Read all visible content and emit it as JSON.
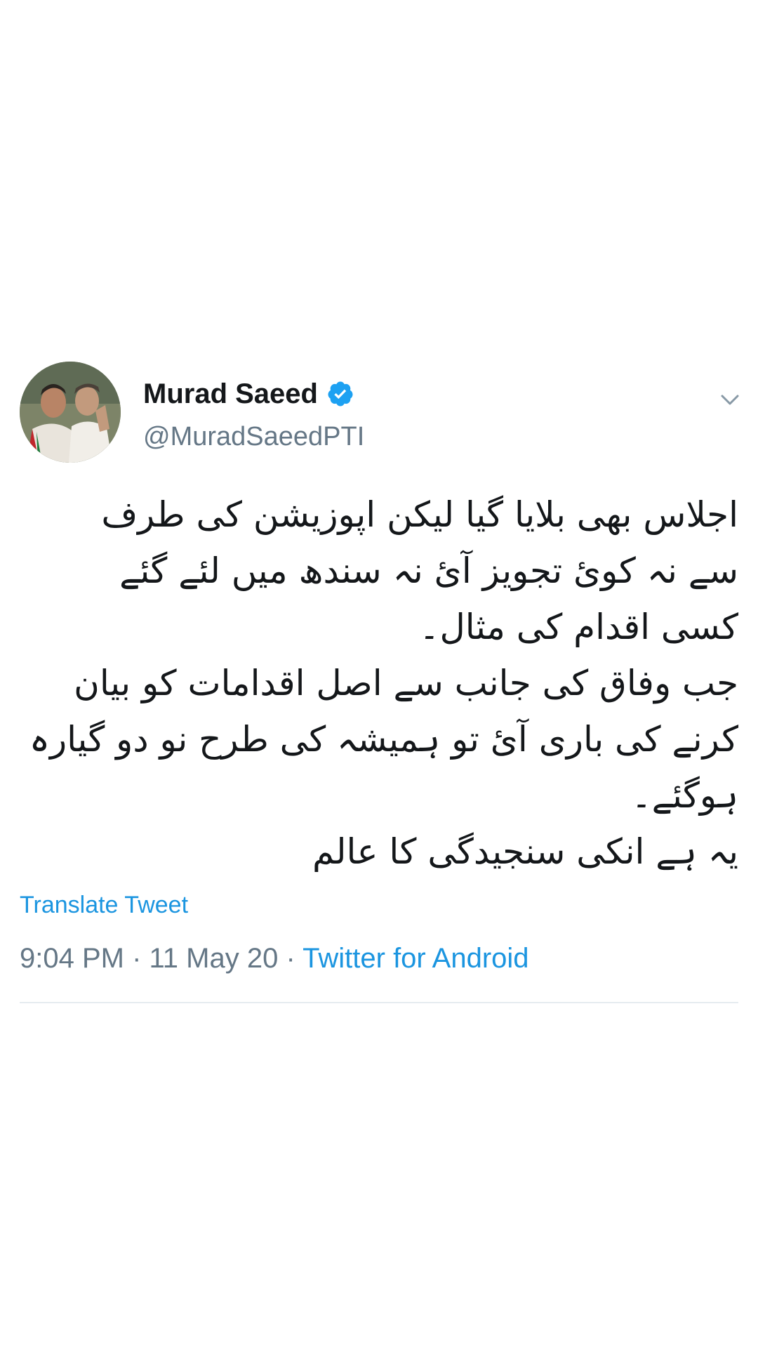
{
  "tweet": {
    "display_name": "Murad Saeed",
    "verified_icon": "verified-badge-icon",
    "handle": "@MuradSaeedPTI",
    "more_icon": "chevron-down-icon",
    "text_lines": [
      "اجلاس بھی بلایا گیا لیکن اپوزیشن کی طرف",
      "سے نہ کوئ تجویز آئ نہ سندھ میں لئے گئے",
      "کسی اقدام کی مثال۔",
      "جب وفاق کی جانب سے اصل اقدامات  کو بیان",
      "کرنے کی باری آئ تو ہمیشہ کی طرح نو دو گیارہ",
      "ہوگئے۔",
      "یہ ہے انکی سنجیدگی کا عالم"
    ],
    "translate_label": "Translate Tweet",
    "time": "9:04 PM",
    "separator_1": " · ",
    "date": "11 May 20",
    "separator_2": " · ",
    "source": "Twitter for Android"
  },
  "colors": {
    "link_blue": "#1b95e0",
    "muted_gray": "#657786",
    "text_dark": "#14171a",
    "verified_blue": "#1da1f2",
    "divider": "#e6ecf0"
  }
}
